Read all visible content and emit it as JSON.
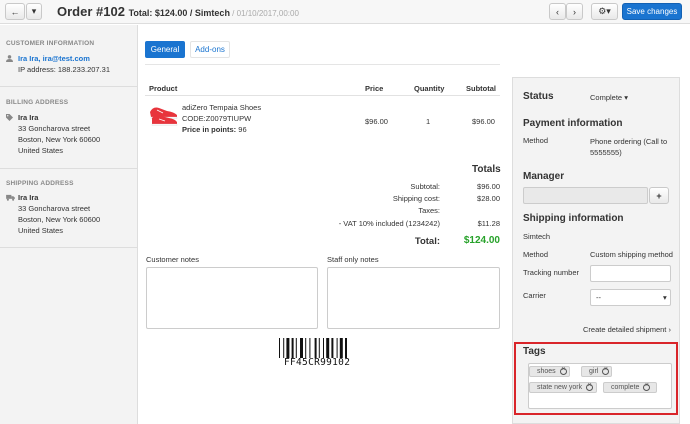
{
  "header": {
    "order_title": "Order #102",
    "total_text": "Total: $124.00 / Simtech",
    "date_text": " / 01/10/2017,00:00",
    "save_label": "Save changes",
    "back_glyph": "←",
    "dropdown_glyph": "▾",
    "prev_glyph": "‹",
    "next_glyph": "›",
    "gear_glyph": "⚙▾"
  },
  "sidebar": {
    "customer": {
      "heading": "Customer information",
      "name_email": "Ira Ira, ira@test.com",
      "ip": "IP address: 188.233.207.31"
    },
    "billing": {
      "heading": "Billing address",
      "name": "Ira Ira",
      "street": "33 Goncharova street",
      "city": "Boston, New York 60600",
      "country": "United States"
    },
    "shipping": {
      "heading": "Shipping address",
      "name": "Ira Ira",
      "street": "33 Goncharova street",
      "city": "Boston, New York 60600",
      "country": "United States"
    }
  },
  "tabs": [
    {
      "label": "General",
      "active": true
    },
    {
      "label": "Add-ons",
      "active": false
    }
  ],
  "products": {
    "columns": [
      "Product",
      "Price",
      "Quantity",
      "Subtotal"
    ],
    "rows": [
      {
        "name": "adiZero Tempaia Shoes",
        "code": "CODE:Z0079TIUPW",
        "points_label": "Price in points:",
        "points_value": "96",
        "price": "$96.00",
        "quantity": "1",
        "subtotal": "$96.00"
      }
    ]
  },
  "totals": {
    "heading": "Totals",
    "subtotal_label": "Subtotal:",
    "subtotal_value": "$96.00",
    "shipping_label": "Shipping cost:",
    "shipping_value": "$28.00",
    "taxes_label": "Taxes:",
    "vat_label": "- VAT 10% included (1234242)",
    "vat_value": "$11.28",
    "total_label": "Total:",
    "total_value": "$124.00"
  },
  "notes": {
    "customer_label": "Customer notes",
    "staff_label": "Staff only notes"
  },
  "barcode": {
    "text": "FF45CR99102"
  },
  "right_panel": {
    "status_heading": "Status",
    "status_value": "Complete",
    "payment_heading": "Payment information",
    "method_label": "Method",
    "payment_method": "Phone ordering (Call to 5555555)",
    "manager_heading": "Manager",
    "add_glyph": "+",
    "shipping_heading": "Shipping information",
    "carrier_company": "Simtech",
    "shipping_method_label": "Method",
    "shipping_method": "Custom shipping method",
    "tracking_label": "Tracking number",
    "carrier_label": "Carrier",
    "carrier_value": "--",
    "create_shipment_link": "Create detailed shipment ›",
    "tags_heading": "Tags",
    "tags": [
      "shoes",
      "girl",
      "state new york",
      "complete"
    ]
  },
  "colors": {
    "primary": "#1a74d0",
    "total_green": "#27a22a",
    "highlight_red": "#d9252a"
  }
}
